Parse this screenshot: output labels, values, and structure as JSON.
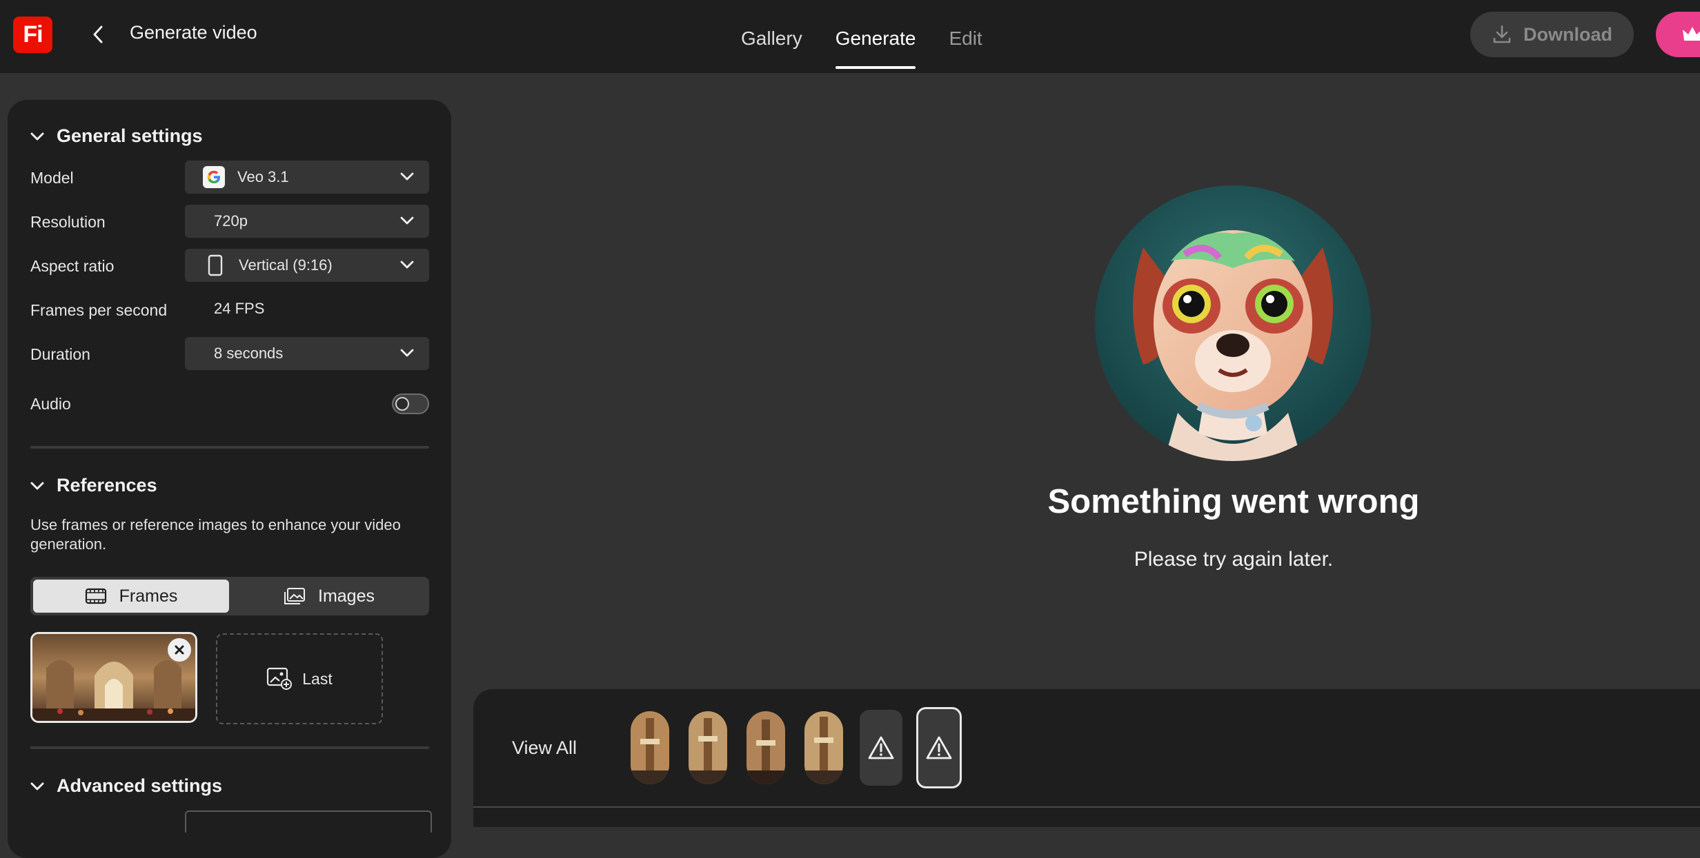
{
  "app": {
    "logo_text": "Fi",
    "page_title": "Generate video",
    "brand_color": "#eb1000"
  },
  "nav": {
    "tabs": [
      {
        "label": "Gallery",
        "state": "normal"
      },
      {
        "label": "Generate",
        "state": "active"
      },
      {
        "label": "Edit",
        "state": "dim"
      }
    ],
    "download_label": "Download",
    "premium_icon": "crown-icon"
  },
  "general_settings": {
    "heading": "General settings",
    "model": {
      "label": "Model",
      "value": "Veo 3.1",
      "icon": "google-icon"
    },
    "resolution": {
      "label": "Resolution",
      "value": "720p"
    },
    "aspect_ratio": {
      "label": "Aspect ratio",
      "value": "Vertical (9:16)",
      "icon": "portrait-icon"
    },
    "fps": {
      "label": "Frames per second",
      "value": "24 FPS"
    },
    "duration": {
      "label": "Duration",
      "value": "8 seconds"
    },
    "audio": {
      "label": "Audio",
      "enabled": false
    }
  },
  "references": {
    "heading": "References",
    "description": "Use frames or reference images to enhance your video generation.",
    "segments": [
      {
        "label": "Frames",
        "selected": true,
        "icon": "film-frame-icon"
      },
      {
        "label": "Images",
        "selected": false,
        "icon": "images-icon"
      }
    ],
    "last_slot_label": "Last"
  },
  "advanced_settings": {
    "heading": "Advanced settings"
  },
  "result": {
    "error_title": "Something went wrong",
    "error_subtitle": "Please try again later."
  },
  "history": {
    "view_all_label": "View All",
    "items": [
      "thumbnail",
      "thumbnail",
      "thumbnail",
      "thumbnail",
      "warning",
      "warning-selected"
    ]
  }
}
